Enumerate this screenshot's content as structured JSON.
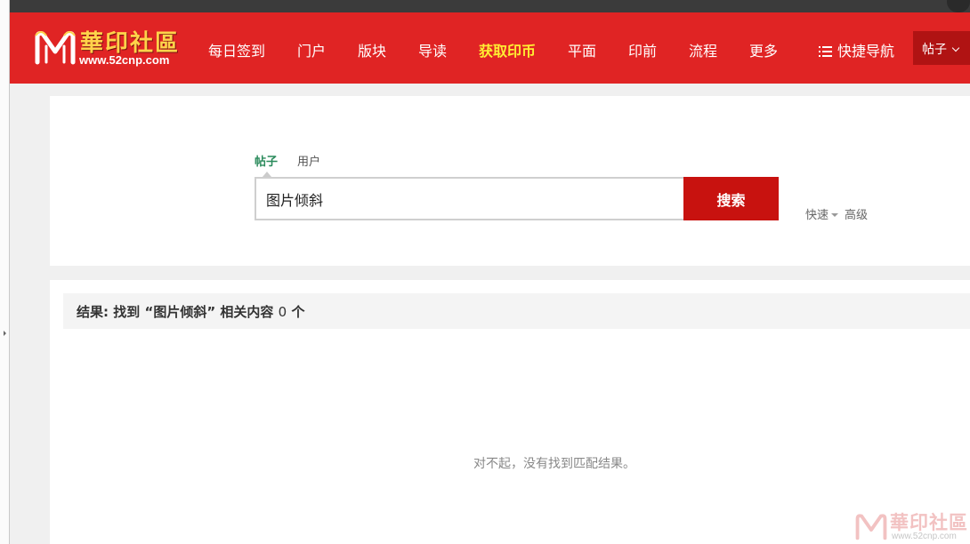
{
  "colors": {
    "header_red": "#e02424",
    "search_button": "#c8120f",
    "highlight_nav": "#ffee33",
    "active_tab": "#2a8a5b"
  },
  "logo": {
    "title": "華印社區",
    "url": "www.52cnp.com",
    "icon": "logo-m-icon"
  },
  "nav": {
    "items": [
      "每日签到",
      "门户",
      "版块",
      "导读",
      "获取印币",
      "平面",
      "印前",
      "流程",
      "更多"
    ],
    "highlight_index": 4,
    "quick_nav_label": "快捷导航",
    "quick_nav_icon": "list-icon",
    "post_select_label": "帖子"
  },
  "search": {
    "tabs": [
      "帖子",
      "用户"
    ],
    "active_tab": 0,
    "query": "图片倾斜",
    "button_label": "搜索",
    "modes": [
      "快速",
      "高级"
    ]
  },
  "results": {
    "prefix": "结果: 找到",
    "query_quoted": "“图片倾斜”",
    "mid": "相关内容",
    "count": "0",
    "suffix": "个",
    "empty_message": "对不起，没有找到匹配结果。"
  },
  "watermark": {
    "title": "華印社區",
    "url": "www.52cnp.com"
  }
}
